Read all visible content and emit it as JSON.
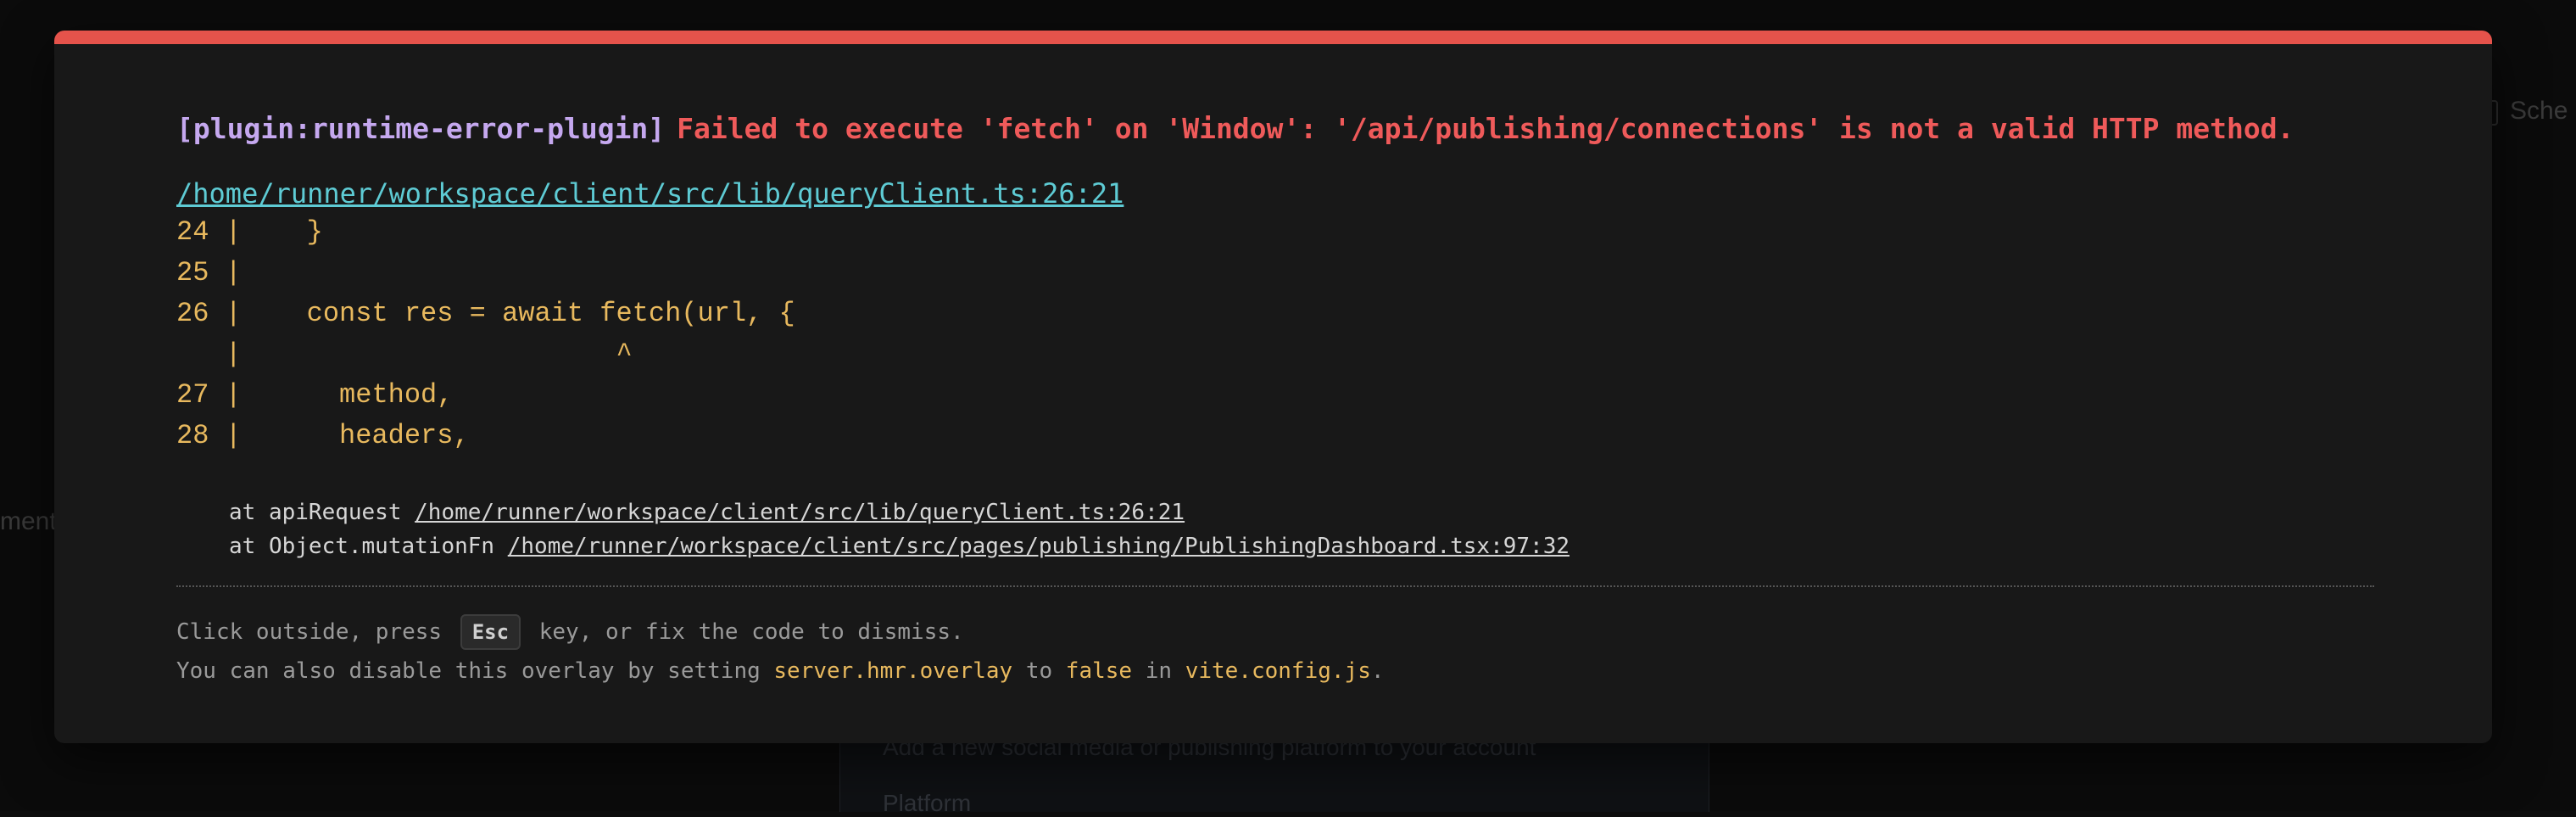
{
  "background": {
    "left_fragment": "ment",
    "right_fragment": "Sche",
    "dialog_subtitle": "Add a new social media or publishing platform to your account",
    "dialog_field_label": "Platform"
  },
  "overlay": {
    "accent_color": "#e5534b",
    "plugin_tag": "[plugin:runtime-error-plugin]",
    "message": "Failed to execute 'fetch' on 'Window': '/api/publishing/connections' is not a valid HTTP method.",
    "file": "/home/runner/workspace/client/src/lib/queryClient.ts:26:21",
    "frame_lines": [
      "24 |    }",
      "25 |",
      "26 |    const res = await fetch(url, {",
      "   |                       ^",
      "27 |      method,",
      "28 |      headers,"
    ],
    "stack": [
      {
        "prefix": "at apiRequest",
        "location": "/home/runner/workspace/client/src/lib/queryClient.ts:26:21"
      },
      {
        "prefix": "at Object.mutationFn",
        "location": "/home/runner/workspace/client/src/pages/publishing/PublishingDashboard.tsx:97:32"
      }
    ],
    "tip": {
      "line1_before": "Click outside, press",
      "key": "Esc",
      "line1_after": "key, or fix the code to dismiss.",
      "line2_before": "You can also disable this overlay by setting",
      "setting": "server.hmr.overlay",
      "line2_mid": "to",
      "value": "false",
      "line2_in": "in",
      "config_file": "vite.config.js",
      "line2_end": "."
    }
  }
}
